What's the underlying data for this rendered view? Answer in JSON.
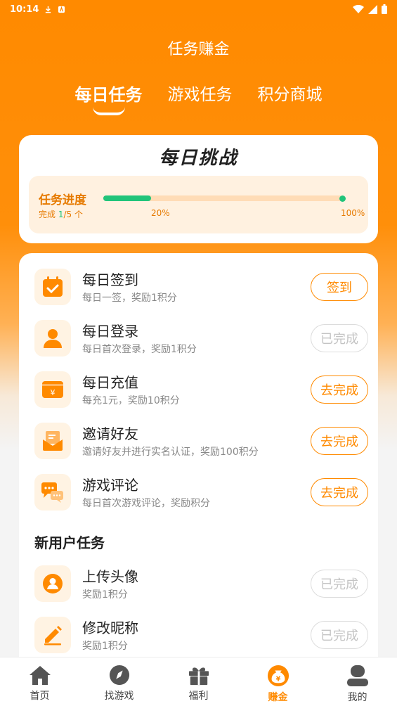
{
  "status_bar": {
    "time": "10:14"
  },
  "header": {
    "title": "任务赚金"
  },
  "tabs": [
    {
      "label": "每日任务",
      "active": true
    },
    {
      "label": "游戏任务",
      "active": false
    },
    {
      "label": "积分商城",
      "active": false
    }
  ],
  "challenge": {
    "title": "每日挑战",
    "progress_label": "任务进度",
    "completed_prefix": "完成 ",
    "completed": "1",
    "total": "/5 个",
    "progress_fraction": 0.2,
    "current_pct": "20%",
    "end_pct": "100%"
  },
  "daily_tasks": [
    {
      "name": "每日签到",
      "desc": "每日一签，奖励1积分",
      "button": "签到",
      "done": false,
      "icon": "calendar-check-icon"
    },
    {
      "name": "每日登录",
      "desc": "每日首次登录，奖励1积分",
      "button": "已完成",
      "done": true,
      "icon": "user-icon"
    },
    {
      "name": "每日充值",
      "desc": "每充1元，奖励10积分",
      "button": "去完成",
      "done": false,
      "icon": "wallet-yen-icon"
    },
    {
      "name": "邀请好友",
      "desc": "邀请好友并进行实名认证，奖励100积分",
      "button": "去完成",
      "done": false,
      "icon": "envelope-icon"
    },
    {
      "name": "游戏评论",
      "desc": "每日首次游戏评论，奖励积分",
      "button": "去完成",
      "done": false,
      "icon": "comment-icon"
    }
  ],
  "new_user_section": {
    "title": "新用户任务"
  },
  "new_user_tasks": [
    {
      "name": "上传头像",
      "desc": "奖励1积分",
      "button": "已完成",
      "done": true,
      "icon": "avatar-icon"
    },
    {
      "name": "修改昵称",
      "desc": "奖励1积分",
      "button": "已完成",
      "done": true,
      "icon": "pencil-icon"
    }
  ],
  "bottom_nav": [
    {
      "label": "首页",
      "icon": "home-icon",
      "active": false
    },
    {
      "label": "找游戏",
      "icon": "compass-icon",
      "active": false
    },
    {
      "label": "福利",
      "icon": "gift-icon",
      "active": false
    },
    {
      "label": "赚金",
      "icon": "money-bag-icon",
      "active": true
    },
    {
      "label": "我的",
      "icon": "profile-icon",
      "active": false
    }
  ],
  "colors": {
    "primary": "#ff8a00",
    "success": "#21c47a",
    "muted": "#c4c4c4"
  }
}
